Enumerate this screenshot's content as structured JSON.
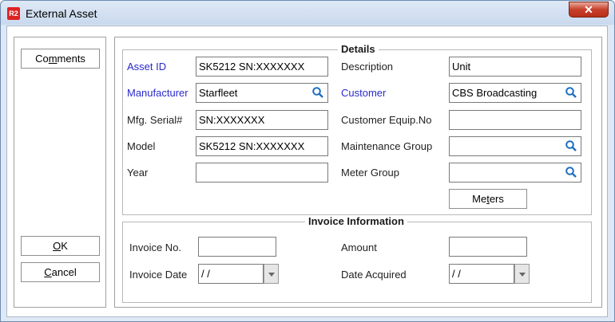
{
  "window": {
    "title": "External Asset",
    "app_icon": "R2",
    "close_glyph": "✕"
  },
  "left": {
    "comments": {
      "pre": "Co",
      "key": "m",
      "post": "ments"
    },
    "ok": {
      "pre": "",
      "key": "O",
      "post": "K"
    },
    "cancel": {
      "pre": "",
      "key": "C",
      "post": "ancel"
    }
  },
  "details": {
    "legend": "Details",
    "asset_id": {
      "label": "Asset ID",
      "value": "SK5212 SN:XXXXXXX"
    },
    "manufacturer": {
      "label": "Manufacturer",
      "value": "Starfleet"
    },
    "mfg_serial": {
      "label": "Mfg. Serial#",
      "value": "SN:XXXXXXX"
    },
    "model": {
      "label": "Model",
      "value": "SK5212 SN:XXXXXXX"
    },
    "year": {
      "label": "Year",
      "value": ""
    },
    "description": {
      "label": "Description",
      "value": "Unit"
    },
    "customer": {
      "label": "Customer",
      "value": "CBS Broadcasting"
    },
    "customer_equip": {
      "label": "Customer Equip.No",
      "value": ""
    },
    "maintenance_group": {
      "label": "Maintenance Group",
      "value": ""
    },
    "meter_group": {
      "label": "Meter Group",
      "value": ""
    },
    "meters_button": {
      "pre": "Me",
      "key": "t",
      "post": "ers"
    }
  },
  "invoice": {
    "legend": "Invoice Information",
    "invoice_no": {
      "label": "Invoice No.",
      "value": ""
    },
    "invoice_date": {
      "label": "Invoice Date",
      "value": " /  /"
    },
    "amount": {
      "label": "Amount",
      "value": ""
    },
    "date_acquired": {
      "label": "Date Acquired",
      "value": " /  /"
    }
  },
  "colors": {
    "required_label": "#2a2acd",
    "lookup_icon": "#1f6fc0"
  },
  "icons": {
    "lookup": "magnifier-icon",
    "dropdown": "chevron-down-icon"
  }
}
